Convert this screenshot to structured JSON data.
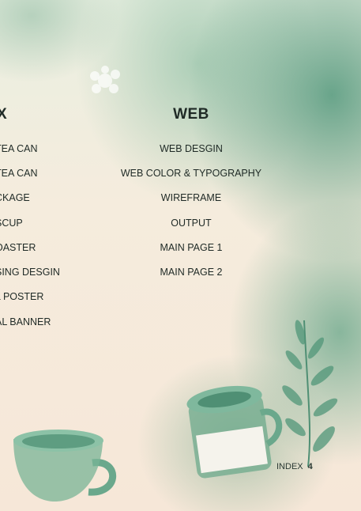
{
  "left_column": {
    "heading": "X",
    "items": [
      "TEA CAN",
      " TEA CAN",
      "CKAGE",
      "SCUP",
      "OASTER",
      "SING DESGIN",
      "L POSTER",
      "AL BANNER"
    ]
  },
  "web_column": {
    "heading": "WEB",
    "items": [
      "WEB DESGIN",
      "WEB COLOR & TYPOGRAPHY",
      "WIREFRAME",
      "OUTPUT",
      "MAIN PAGE 1",
      "MAIN PAGE 2"
    ]
  },
  "footer": {
    "label": "INDEX",
    "page_number": "4"
  },
  "colors": {
    "accent_green": "#5a9c80",
    "text": "#1f2a26"
  },
  "decorations": [
    "teacup-illustration",
    "tea-can-illustration",
    "leaf-branch-illustration",
    "lace-flower-illustration"
  ]
}
